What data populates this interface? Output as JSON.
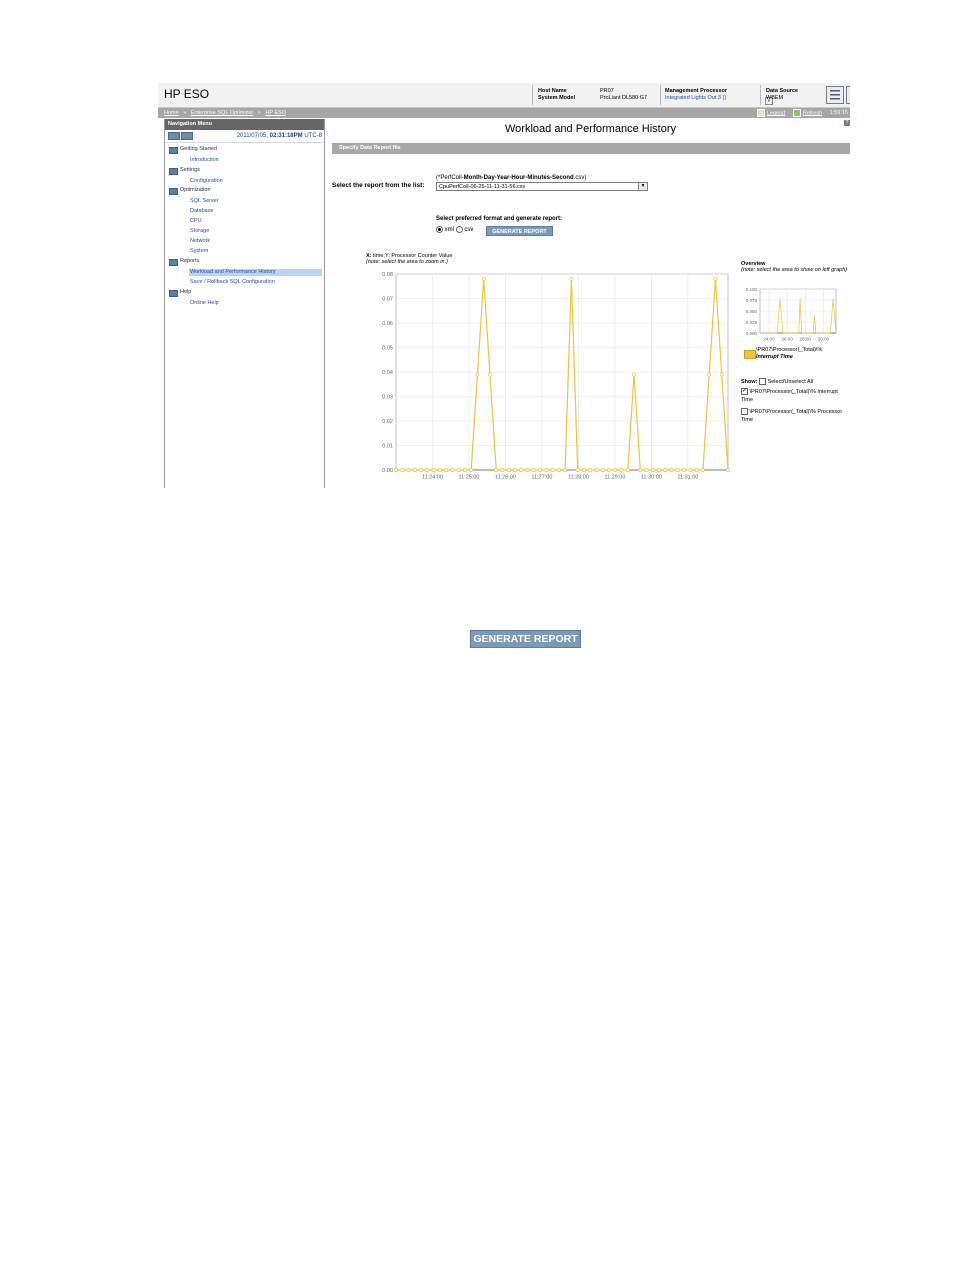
{
  "header": {
    "app_title": "HP ESO",
    "host_name_label": "Host Name",
    "host_name_value": "PR07",
    "system_model_label": "System Model",
    "system_model_value": "ProLiant DL580 G7",
    "mp_label": "Management Processor",
    "mp_value": "Integrated Lights Out 3 ()",
    "data_source_label": "Data Source",
    "data_source_value": "WBEM"
  },
  "breadcrumb": {
    "items": [
      "Home",
      "Enterprise SQL Optimizer",
      "HP ESO"
    ],
    "separator": "»",
    "legend_label": "Legend",
    "refresh_label": "Refresh",
    "time": "1:59:15"
  },
  "nav": {
    "title": "Navigation Menu",
    "date_prefix": "2011/07/05,",
    "date_time": "02:31:18PM",
    "date_suffix": "UTC-8",
    "groups": [
      {
        "label": "Getting Started",
        "items": [
          "Introduction"
        ]
      },
      {
        "label": "Settings",
        "items": [
          "Configuration"
        ]
      },
      {
        "label": "Optimization",
        "items": [
          "SQL Server",
          "Database",
          "CPU",
          "Storage",
          "Network",
          "System"
        ]
      },
      {
        "label": "Reports",
        "items": [
          "Workload and Performance History",
          "Save / Rollback SQL Configuration"
        ]
      },
      {
        "label": "Help",
        "items": [
          "Online Help"
        ]
      }
    ],
    "selected": "Workload and Performance History"
  },
  "content": {
    "page_title": "Workload and Performance History",
    "section_label": "Specify Data Report file",
    "select_label": "Select the report from the list:",
    "format_hint_prefix": "(*PerfColl-",
    "format_hint_bold": "Month-Day-Year-Hour-Minutes-Second",
    "format_hint_suffix": ".csv)",
    "selected_file": "CpuPerfColl-06-25-11-11-31-56.csv",
    "format_label": "Select preferred format and generate report:",
    "format_options": [
      "xml",
      "csv"
    ],
    "format_selected": "xml",
    "generate_label": "GENERATE REPORT"
  },
  "chart_area": {
    "chart_title_bold": "X:",
    "chart_title_rest": "time,Y: Processor Counter Value",
    "chart_note": "(note: select the area to zoom in.)",
    "overview_title": "Overview",
    "overview_note": "(note: select the area to show on left graph)",
    "legend_series": "\\PR07\\Processor(_Total)\\%",
    "legend_series_sub": "Interrupt Time",
    "show_label": "Show:",
    "select_all_label": "Select/Unselect All",
    "show_items": [
      {
        "label": "\\PR07\\Processor(_Total)\\% Interrupt Time",
        "checked": true
      },
      {
        "label": "\\PR07\\Processor(_Total)\\% Processor Time",
        "checked": false
      }
    ],
    "series_color": "#f2c23a"
  },
  "chart_data": [
    {
      "type": "line",
      "title": "X: time,Y: Processor Counter Value",
      "x_ticks": [
        "11:24:00",
        "11:25:00",
        "11:26:00",
        "11:27:00",
        "11:28:00",
        "11:29:00",
        "11:30:00",
        "11:31:00"
      ],
      "y_ticks": [
        "0.00",
        "0.01",
        "0.02",
        "0.03",
        "0.04",
        "0.05",
        "0.06",
        "0.07",
        "0.08"
      ],
      "ylim": [
        0,
        0.08
      ],
      "grid": true,
      "series": [
        {
          "name": "\\PR07\\Processor(_Total)\\% Interrupt Time",
          "x": [
            0,
            0.15,
            0.3,
            0.45,
            0.6,
            0.75,
            0.9,
            1.05,
            1.2,
            1.35,
            1.5,
            1.65,
            1.8,
            1.95,
            2.1,
            2.25,
            2.4,
            2.55,
            2.7,
            2.85,
            3.0,
            3.15,
            3.3,
            3.45,
            3.6,
            3.75,
            3.9,
            4.05,
            4.2,
            4.35,
            4.5,
            4.65,
            4.8,
            4.95,
            5.1,
            5.25,
            5.4,
            5.55,
            5.7,
            5.85,
            6.0,
            6.15,
            6.3,
            6.45,
            6.6,
            6.75,
            6.9,
            7.05,
            7.2,
            7.35,
            7.5,
            7.65,
            7.8,
            7.95
          ],
          "values": [
            0,
            0,
            0,
            0,
            0,
            0,
            0,
            0,
            0,
            0,
            0,
            0,
            0,
            0.039,
            0.078,
            0.039,
            0,
            0,
            0,
            0,
            0,
            0,
            0,
            0,
            0,
            0,
            0,
            0,
            0.078,
            0,
            0,
            0,
            0,
            0,
            0,
            0,
            0,
            0,
            0.039,
            0,
            0,
            0,
            0,
            0,
            0,
            0,
            0,
            0,
            0,
            0,
            0.039,
            0.078,
            0.039,
            0
          ]
        }
      ]
    },
    {
      "type": "line",
      "title": "Overview",
      "x_ticks": [
        "24:00",
        "26:00",
        "28:00",
        "30:00"
      ],
      "y_ticks": [
        "0.000",
        "0.025",
        "0.050",
        "0.075",
        "0.100"
      ],
      "ylim": [
        0,
        0.1
      ],
      "grid": true,
      "series": [
        {
          "name": "\\PR07\\Processor(_Total)\\% Interrupt Time",
          "x": [
            0,
            0.15,
            0.3,
            0.45,
            0.6,
            0.75,
            0.9,
            1.05,
            1.2,
            1.35,
            1.5,
            1.65,
            1.8,
            1.95,
            2.1,
            2.25,
            2.4,
            2.55,
            2.7,
            2.85,
            3.0,
            3.15,
            3.3,
            3.45,
            3.6,
            3.75,
            3.9,
            4.05,
            4.2,
            4.35,
            4.5,
            4.65,
            4.8,
            4.95,
            5.1,
            5.25,
            5.4,
            5.55,
            5.7,
            5.85,
            6.0,
            6.15,
            6.3,
            6.45,
            6.6,
            6.75,
            6.9,
            7.05,
            7.2,
            7.35,
            7.5,
            7.65,
            7.8,
            7.95
          ],
          "values": [
            0,
            0,
            0,
            0,
            0,
            0,
            0,
            0,
            0,
            0,
            0,
            0,
            0,
            0.039,
            0.078,
            0.039,
            0,
            0,
            0,
            0,
            0,
            0,
            0,
            0,
            0,
            0,
            0,
            0,
            0.078,
            0,
            0,
            0,
            0,
            0,
            0,
            0,
            0,
            0,
            0.039,
            0,
            0,
            0,
            0,
            0,
            0,
            0,
            0,
            0,
            0,
            0,
            0.039,
            0.078,
            0.039,
            0
          ]
        }
      ]
    }
  ],
  "footer_button": {
    "label": "GENERATE REPORT"
  }
}
